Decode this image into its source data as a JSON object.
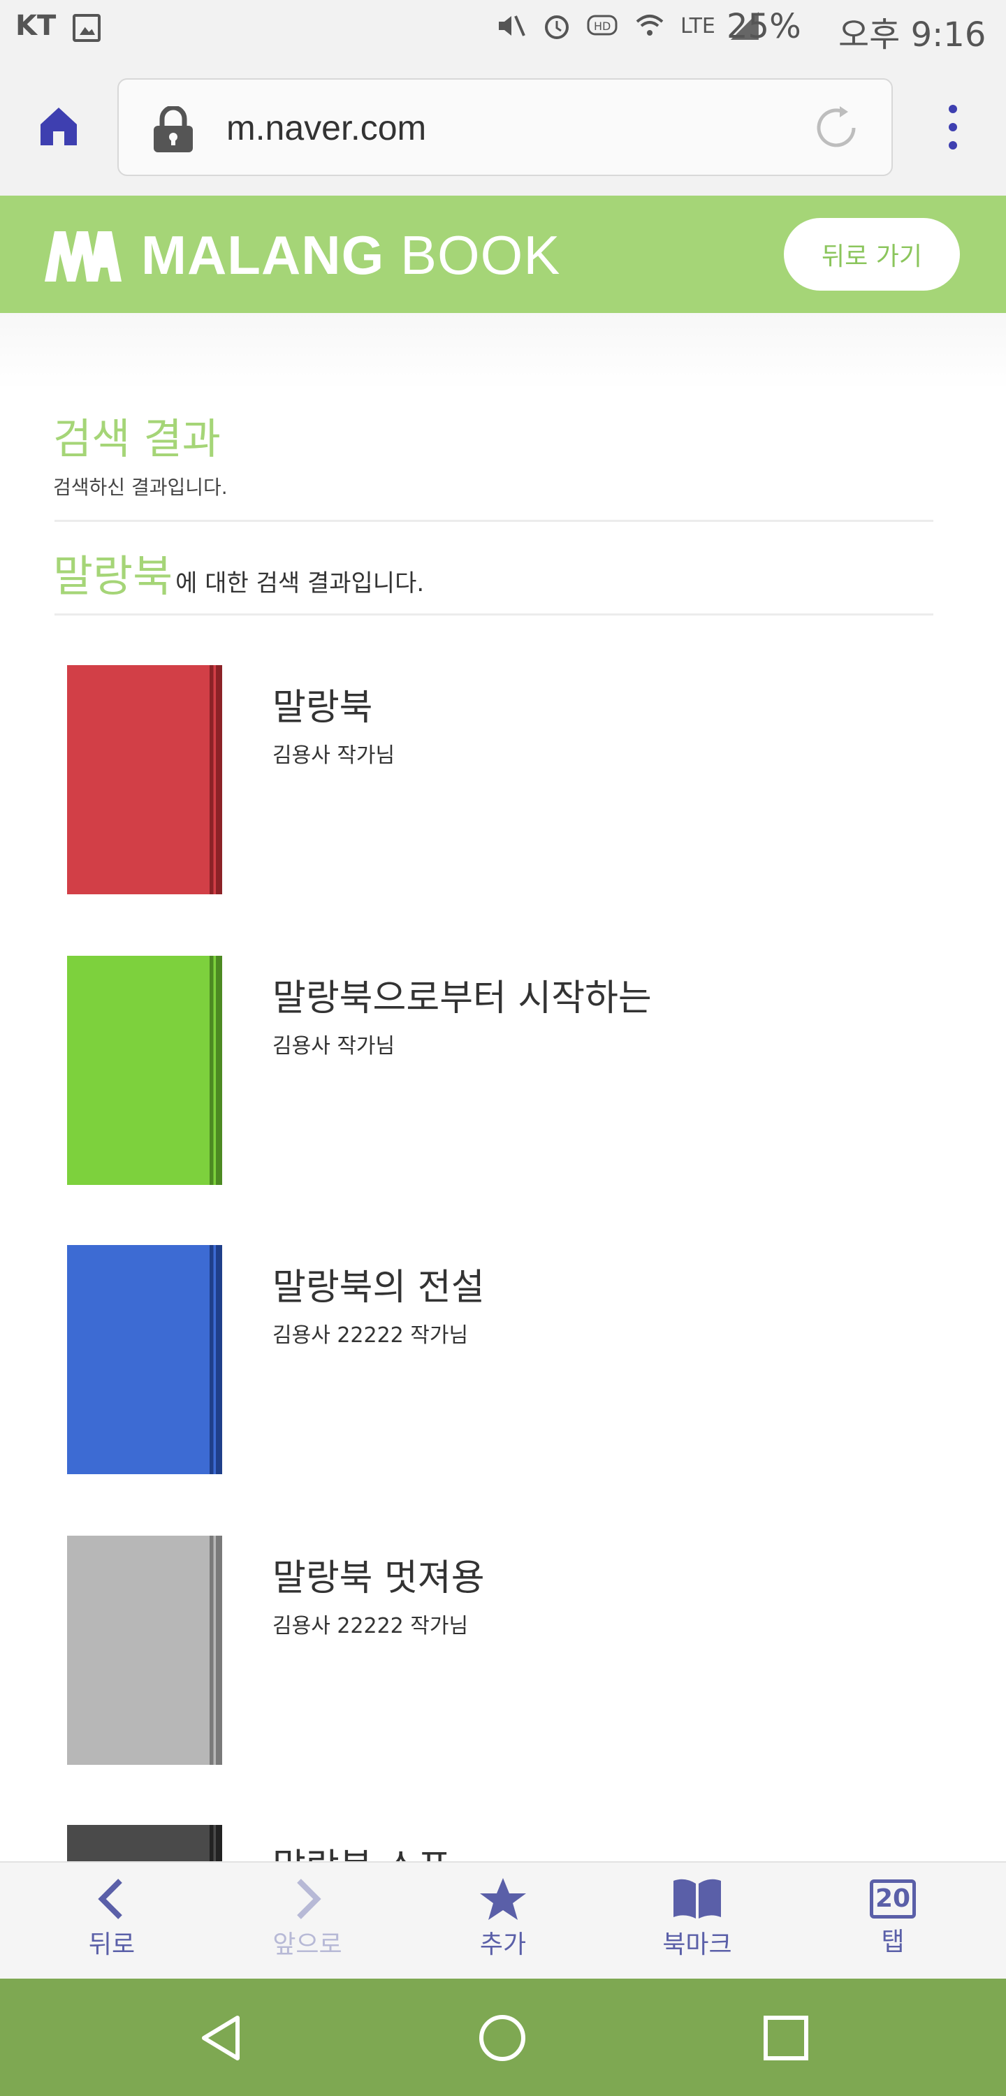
{
  "status_bar": {
    "carrier": "KT",
    "network": "LTE",
    "battery": "25%",
    "time": "오후 9:16"
  },
  "browser": {
    "url": "m.naver.com"
  },
  "header": {
    "logo_bold": "MALANG",
    "logo_light": "BOOK",
    "back_button": "뒤로 가기"
  },
  "search": {
    "title": "검색 결과",
    "subtitle": "검색하신 결과입니다.",
    "query": "말랑북",
    "query_suffix": "에 대한 검색 결과입니다."
  },
  "books": [
    {
      "title": "말랑북",
      "author": "김용사 작가님",
      "color": "#d23f47",
      "spine": "#8c2227"
    },
    {
      "title": "말랑북으로부터 시작하는",
      "author": "김용사 작가님",
      "color": "#7dd13d",
      "spine": "#4c8a22"
    },
    {
      "title": "말랑북의 전설",
      "author": "김용사 22222 작가님",
      "color": "#3d6bd3",
      "spine": "#1f3f8a"
    },
    {
      "title": "말랑북 멋져용",
      "author": "김용사 22222 작가님",
      "color": "#b7b7b7",
      "spine": "#7a7a7a"
    },
    {
      "title": "말랑북 스포",
      "author": "",
      "color": "#4a4a4a",
      "spine": "#222222"
    }
  ],
  "toolbar": {
    "back": "뒤로",
    "forward": "앞으로",
    "add": "추가",
    "bookmarks": "북마크",
    "tabs": "탭",
    "tab_count": "20"
  },
  "colors": {
    "brand_green": "#a5d577",
    "nav_green": "#7ea852",
    "toolbar_purple": "#5a5fa8"
  }
}
